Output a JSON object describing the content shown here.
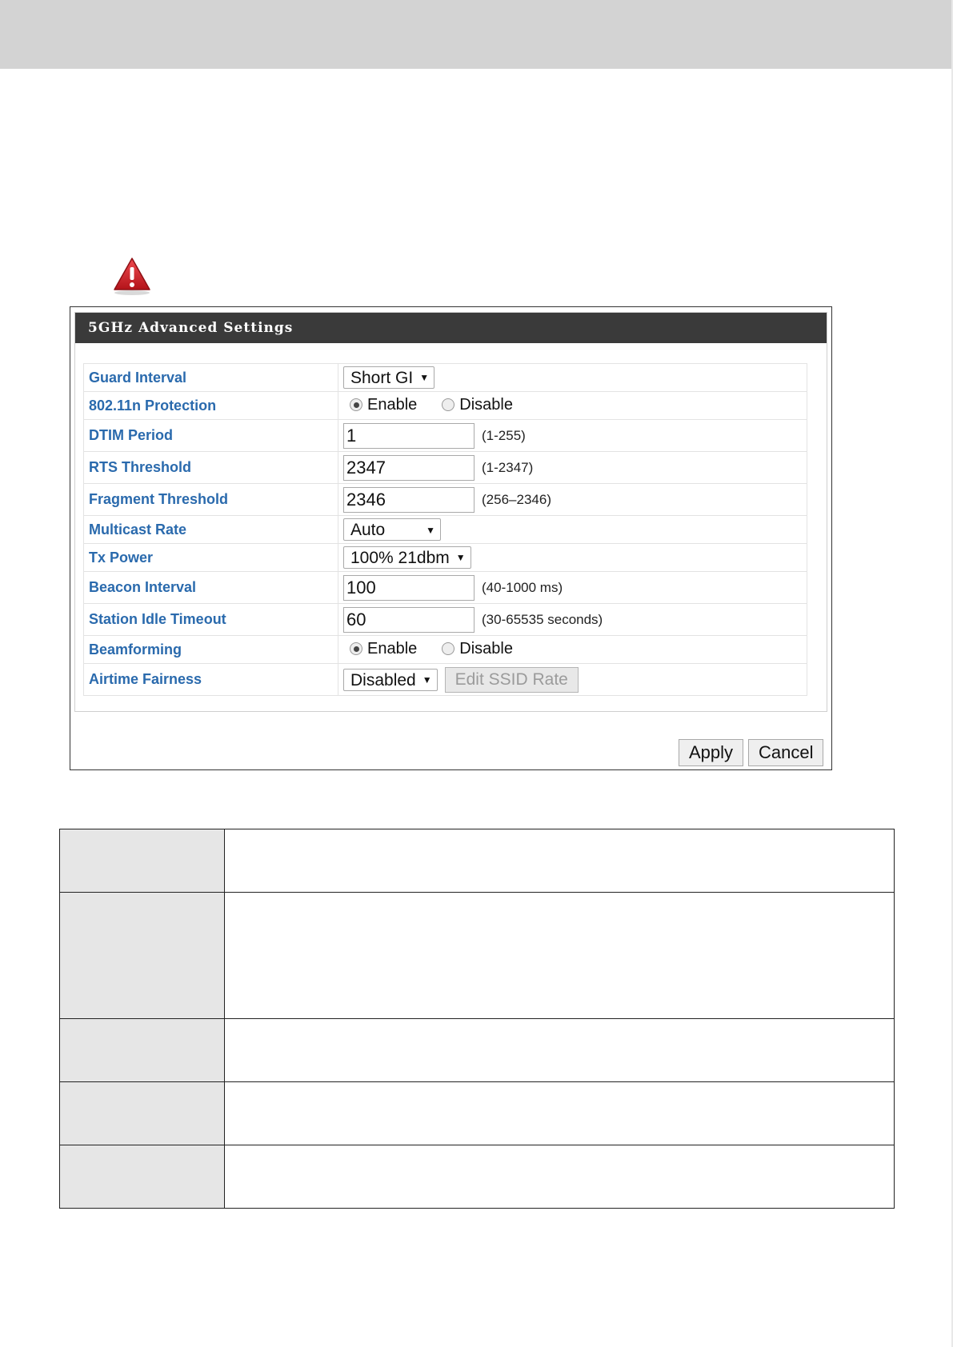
{
  "panel": {
    "title": "5GHz Advanced Settings",
    "rows": [
      {
        "label": "Guard Interval",
        "kind": "select",
        "value": "Short GI"
      },
      {
        "label": "802.11n Protection",
        "kind": "radio",
        "options": [
          "Enable",
          "Disable"
        ],
        "selected": "Enable"
      },
      {
        "label": "DTIM Period",
        "kind": "text",
        "value": "1",
        "hint": "(1-255)"
      },
      {
        "label": "RTS Threshold",
        "kind": "text",
        "value": "2347",
        "hint": "(1-2347)"
      },
      {
        "label": "Fragment Threshold",
        "kind": "text",
        "value": "2346",
        "hint": "(256–2346)"
      },
      {
        "label": "Multicast Rate",
        "kind": "select",
        "value": "Auto"
      },
      {
        "label": "Tx Power",
        "kind": "select",
        "value": "100% 21dbm"
      },
      {
        "label": "Beacon Interval",
        "kind": "text",
        "value": "100",
        "hint": "(40-1000 ms)"
      },
      {
        "label": "Station Idle Timeout",
        "kind": "text",
        "value": "60",
        "hint": "(30-65535 seconds)"
      },
      {
        "label": "Beamforming",
        "kind": "radio",
        "options": [
          "Enable",
          "Disable"
        ],
        "selected": "Enable"
      },
      {
        "label": "Airtime Fairness",
        "kind": "select",
        "value": "Disabled",
        "button": "Edit SSID Rate"
      }
    ],
    "apply_label": "Apply",
    "cancel_label": "Cancel"
  },
  "icons": {
    "warning": "warning-triangle-icon",
    "dropdown": "caret-down-icon"
  },
  "colors": {
    "label_blue": "#2a6aad",
    "header_dark": "#3a3a3a",
    "warning_red": "#d42026"
  }
}
